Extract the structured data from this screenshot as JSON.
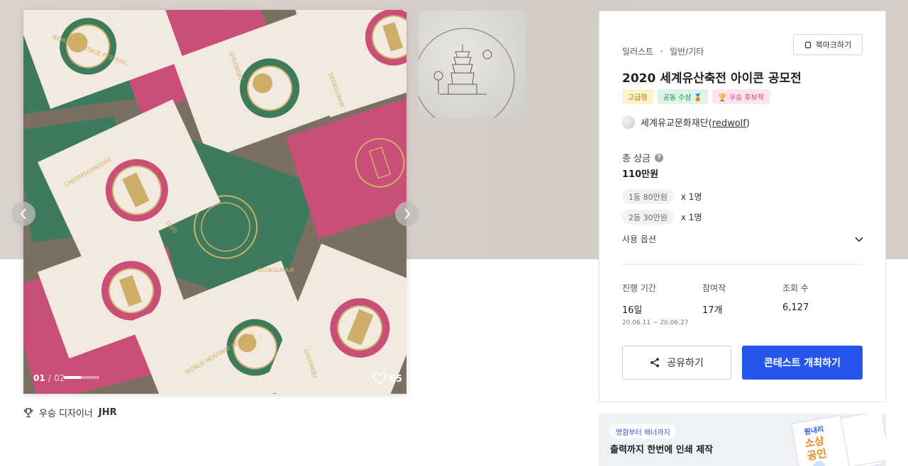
{
  "gallery": {
    "current": "01",
    "total": "02",
    "separator": "/",
    "progress": 0.5,
    "likes": "65",
    "card_texts": [
      "WORLD HERITAGE FESTIVAL",
      "GYEONGJU",
      "SEOKGURAM",
      "CHEOMSEONGDAE",
      "2020"
    ]
  },
  "winner": {
    "label": "우승 디자이너",
    "name": "JHR"
  },
  "contest": {
    "category": "일러스트",
    "subcategory": "일반/기타",
    "bookmark_label": "북마크하기",
    "title": "2020 세계유산축전 아이콘 공모전",
    "badges": [
      "고급형",
      "공동 수상 🥉",
      "🏆 우승 후보작"
    ],
    "owner": "세계유교문화재단",
    "owner_handle_open": "(",
    "owner_handle": "redwolf",
    "owner_handle_close": ")",
    "prize_label": "총 상금",
    "prize_total": "110만원",
    "tiers": [
      {
        "name": "1등 80만원",
        "count": "x 1명"
      },
      {
        "name": "2등 30만원",
        "count": "x 1명"
      }
    ],
    "options_label": "사용 옵션",
    "stats": {
      "period_label": "진행 기간",
      "period_value": "16일",
      "period_range": "20.06.11 ~ 20.06.27",
      "entries_label": "참여작",
      "entries_value": "17개",
      "views_label": "조회 수",
      "views_value": "6,127"
    },
    "share_label": "공유하기",
    "host_label": "콘테스트 개최하기"
  },
  "ad": {
    "tag": "명함부터 배너까지",
    "text": "출력까지 한번에 인쇄 제작",
    "art_text_1": "뭔내리",
    "art_text_2": "소상",
    "art_text_3": "공인"
  },
  "colors": {
    "accent": "#2757ea",
    "pink_card": "#c94f78",
    "green_card": "#3e7a5c",
    "cream_card": "#f2e9df",
    "gold": "#cfae6a"
  }
}
